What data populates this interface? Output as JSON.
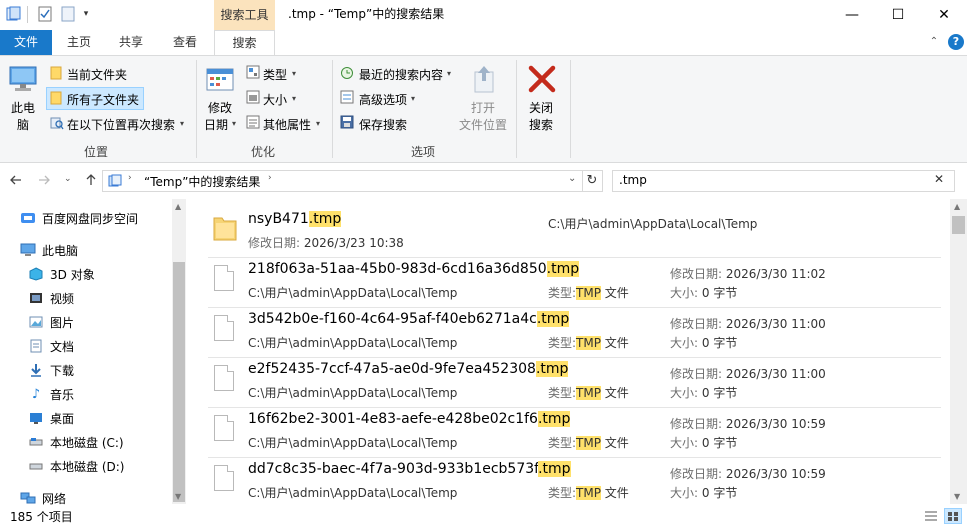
{
  "titlebar": {
    "contextual_tab": "搜索工具",
    "title": ".tmp - “Temp”中的搜索结果",
    "minimize": "—",
    "maximize": "☐",
    "close": "✕"
  },
  "tabs": [
    "文件",
    "主页",
    "共享",
    "查看",
    "搜索"
  ],
  "ribbon": {
    "location": {
      "this_pc_line1": "此电",
      "this_pc_line2": "脑",
      "current_folder": "当前文件夹",
      "all_subfolders": "所有子文件夹",
      "search_again": "在以下位置再次搜索",
      "label": "位置"
    },
    "refine": {
      "modified_line1": "修改",
      "modified_line2": "日期",
      "type": "类型",
      "size": "大小",
      "other_props": "其他属性",
      "label": "优化"
    },
    "options": {
      "recent_searches": "最近的搜索内容",
      "advanced": "高级选项",
      "save_search": "保存搜索",
      "open_location_line1": "打开",
      "open_location_line2": "文件位置",
      "label": "选项"
    },
    "close_search": {
      "line1": "关闭",
      "line2": "搜索"
    }
  },
  "address": {
    "path": "“Temp”中的搜索结果",
    "search_value": ".tmp"
  },
  "nav": [
    {
      "label": "百度网盘同步空间",
      "icon": "cloud-icon"
    },
    {
      "label": "此电脑",
      "icon": "computer-icon"
    },
    {
      "label": "3D 对象",
      "icon": "cube-icon"
    },
    {
      "label": "视频",
      "icon": "video-icon"
    },
    {
      "label": "图片",
      "icon": "picture-icon"
    },
    {
      "label": "文档",
      "icon": "document-icon"
    },
    {
      "label": "下载",
      "icon": "download-icon"
    },
    {
      "label": "音乐",
      "icon": "music-icon"
    },
    {
      "label": "桌面",
      "icon": "desktop-icon"
    },
    {
      "label": "本地磁盘 (C:)",
      "icon": "drive-icon"
    },
    {
      "label": "本地磁盘 (D:)",
      "icon": "drive-icon"
    },
    {
      "label": "网络",
      "icon": "network-icon"
    }
  ],
  "results": {
    "folder": {
      "name_base": "nsyB471",
      "name_ext": ".tmp",
      "modified_label": "修改日期:",
      "modified": "2026/3/23 10:38",
      "path": "C:\\用户\\admin\\AppData\\Local\\Temp"
    },
    "files": [
      {
        "name_base": "218f063a-51aa-45b0-983d-6cd16a36d850",
        "name_ext": ".tmp",
        "path": "C:\\用户\\admin\\AppData\\Local\\Temp",
        "type_label": "类型:",
        "type_hl": "TMP",
        "type_rest": " 文件",
        "modified_label": "修改日期:",
        "modified": "2026/3/30 11:02",
        "size_label": "大小:",
        "size": "0 字节"
      },
      {
        "name_base": "3d542b0e-f160-4c64-95af-f40eb6271a4c",
        "name_ext": ".tmp",
        "path": "C:\\用户\\admin\\AppData\\Local\\Temp",
        "type_label": "类型:",
        "type_hl": "TMP",
        "type_rest": " 文件",
        "modified_label": "修改日期:",
        "modified": "2026/3/30 11:00",
        "size_label": "大小:",
        "size": "0 字节"
      },
      {
        "name_base": "e2f52435-7ccf-47a5-ae0d-9fe7ea452308",
        "name_ext": ".tmp",
        "path": "C:\\用户\\admin\\AppData\\Local\\Temp",
        "type_label": "类型:",
        "type_hl": "TMP",
        "type_rest": " 文件",
        "modified_label": "修改日期:",
        "modified": "2026/3/30 11:00",
        "size_label": "大小:",
        "size": "0 字节"
      },
      {
        "name_base": "16f62be2-3001-4e83-aefe-e428be02c1f6",
        "name_ext": ".tmp",
        "path": "C:\\用户\\admin\\AppData\\Local\\Temp",
        "type_label": "类型:",
        "type_hl": "TMP",
        "type_rest": " 文件",
        "modified_label": "修改日期:",
        "modified": "2026/3/30 10:59",
        "size_label": "大小:",
        "size": "0 字节"
      },
      {
        "name_base": "dd7c8c35-baec-4f7a-903d-933b1ecb573f",
        "name_ext": ".tmp",
        "path": "C:\\用户\\admin\\AppData\\Local\\Temp",
        "type_label": "类型:",
        "type_hl": "TMP",
        "type_rest": " 文件",
        "modified_label": "修改日期:",
        "modified": "2026/3/30 10:59",
        "size_label": "大小:",
        "size": "0 字节"
      }
    ]
  },
  "status": {
    "count": "185 个项目"
  },
  "colors": {
    "accent": "#1979ca",
    "highlight": "#ffe16b",
    "contextual_tab": "#fbe3bd",
    "close_x": "#c42b1c"
  }
}
